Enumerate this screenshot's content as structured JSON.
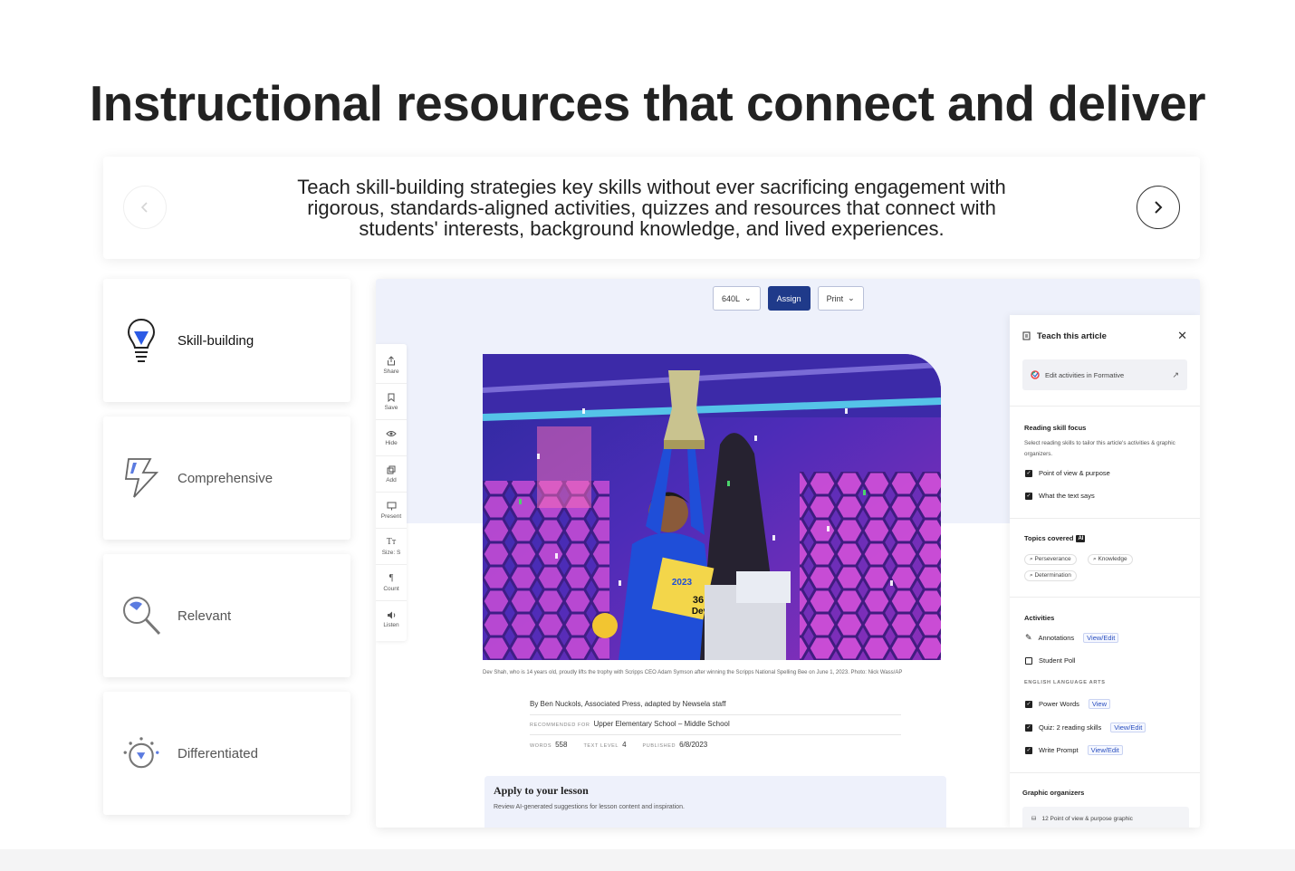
{
  "headline": "Instructional resources that connect and deliver",
  "carousel": {
    "text": "Teach skill-building strategies key skills without ever sacrificing engagement with rigorous, standards-aligned activities, quizzes and resources that connect with students' interests, background knowledge, and lived experiences."
  },
  "tiles": [
    {
      "label": "Skill-building",
      "icon": "lightbulb-icon",
      "active": true
    },
    {
      "label": "Comprehensive",
      "icon": "lightning-icon",
      "active": false
    },
    {
      "label": "Relevant",
      "icon": "magnifier-icon",
      "active": false
    },
    {
      "label": "Differentiated",
      "icon": "dial-icon",
      "active": false
    }
  ],
  "colors": {
    "accent": "#2a4fbf",
    "brand_dark": "#1f3a8a",
    "band": "#eef1fb"
  },
  "app": {
    "toolbar": {
      "level": "640L",
      "assign": "Assign",
      "print": "Print"
    },
    "tools": [
      {
        "label": "Share",
        "icon": "share-icon"
      },
      {
        "label": "Save",
        "icon": "bookmark-icon"
      },
      {
        "label": "Hide",
        "icon": "eye-icon"
      },
      {
        "label": "Add",
        "icon": "add-icon"
      },
      {
        "label": "Present",
        "icon": "present-icon"
      },
      {
        "label": "Size: S",
        "icon": "text-size-icon"
      },
      {
        "label": "Count",
        "icon": "paragraph-icon"
      },
      {
        "label": "Listen",
        "icon": "speaker-icon"
      }
    ],
    "photo": {
      "badge_line1": "2023",
      "badge_num": "36",
      "badge_name": "Dev"
    },
    "caption": "Dev Shah, who is 14 years old, proudly lifts the trophy with Scripps CEO Adam Symson after winning the Scripps National Spelling Bee on June 1, 2023. Photo: Nick Wass/AP",
    "byline": "By Ben Nuckols, Associated Press, adapted by Newsela staff",
    "recommended_label": "Recommended for",
    "recommended_value": "Upper Elementary School – Middle School",
    "words_label": "Words",
    "words_value": "558",
    "text_level_label": "Text level",
    "text_level_value": "4",
    "published_label": "Published",
    "published_value": "6/8/2023",
    "apply_title": "Apply to your lesson",
    "apply_sub": "Review AI-generated suggestions for lesson content and inspiration."
  },
  "panel": {
    "title": "Teach this article",
    "formative": "Edit activities in Formative",
    "reading_h": "Reading skill focus",
    "reading_desc": "Select reading skills to tailor this article's activities & graphic organizers.",
    "skills": [
      "Point of view & purpose",
      "What the text says"
    ],
    "topics_h": "Topics covered",
    "ai": "AI",
    "topics": [
      "Perseverance",
      "Knowledge",
      "Determination"
    ],
    "activities_h": "Activities",
    "annotations": "Annotations",
    "annotations_link": "View/Edit",
    "student_poll": "Student Poll",
    "ela_h": "English Language Arts",
    "power_words": "Power Words",
    "power_words_link": "View",
    "quiz": "Quiz: 2 reading skills",
    "quiz_link": "View/Edit",
    "write_prompt": "Write Prompt",
    "write_prompt_link": "View/Edit",
    "graphic_h": "Graphic organizers",
    "graphic_item": "12 Point of view & purpose graphic"
  }
}
